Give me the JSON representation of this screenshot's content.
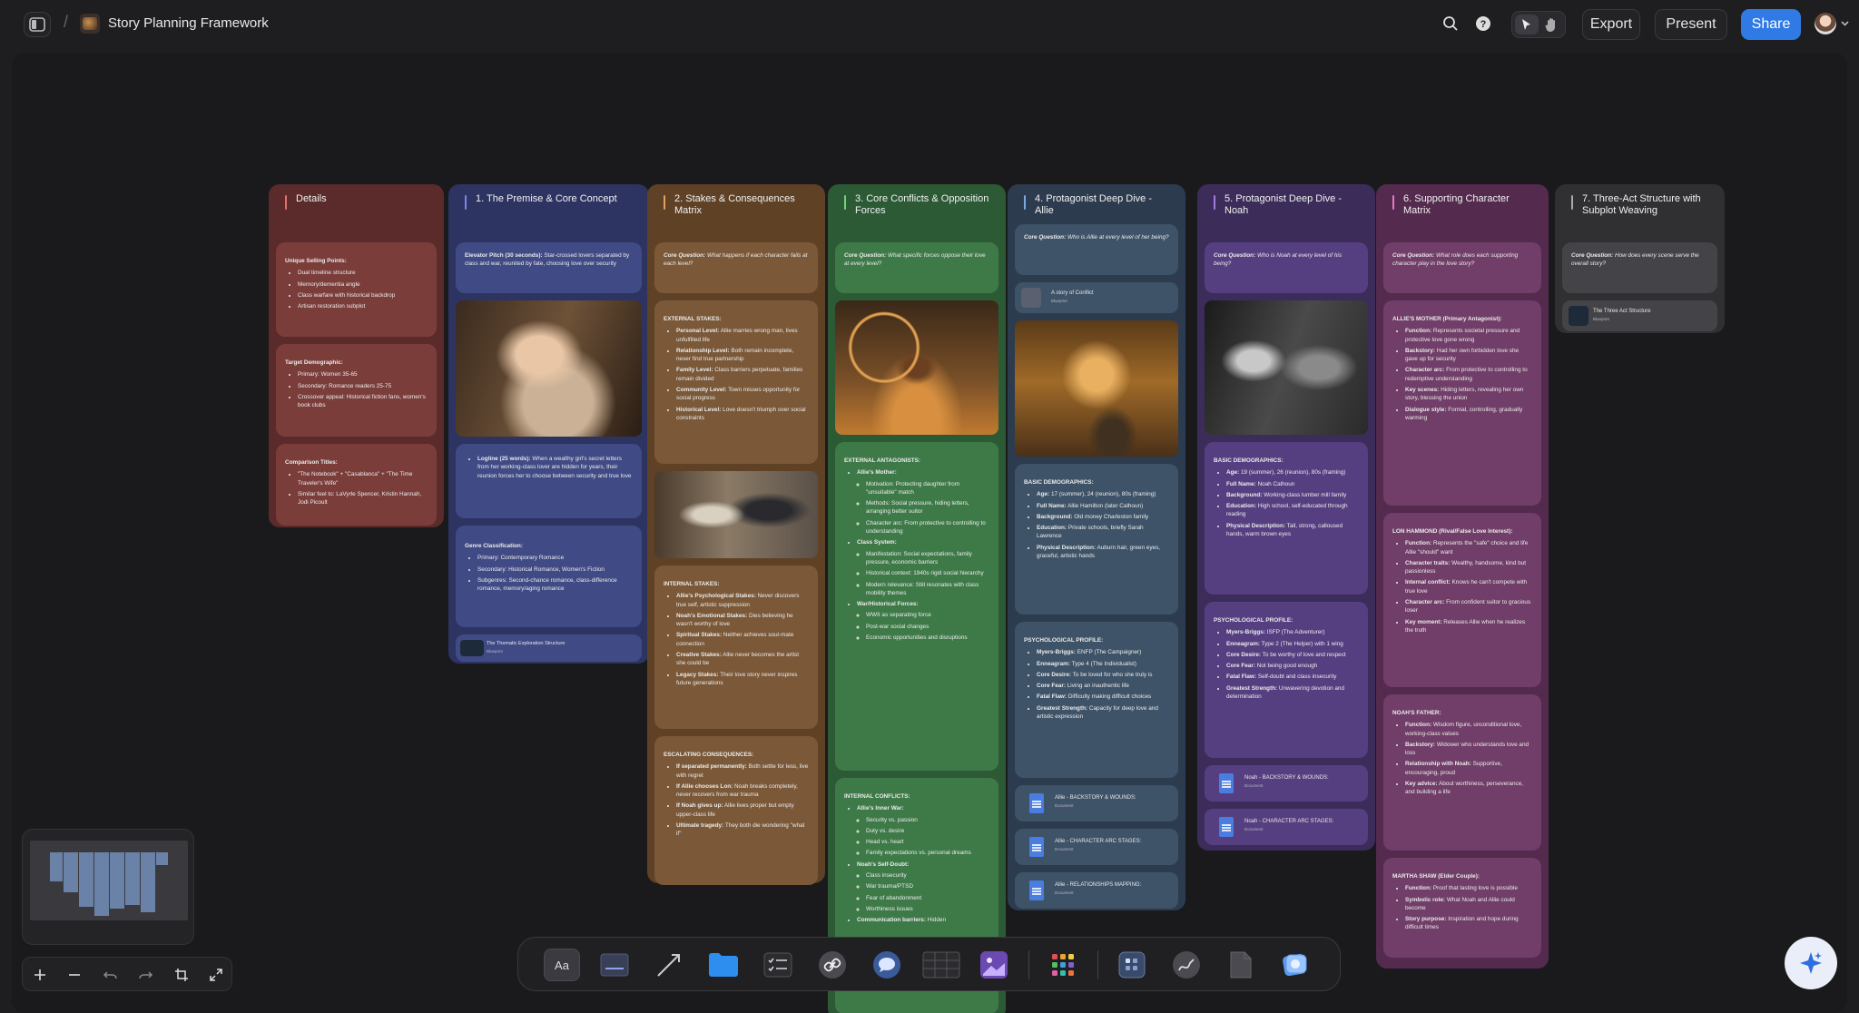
{
  "header": {
    "title": "Story Planning Framework",
    "export_label": "Export",
    "present_label": "Present",
    "share_label": "Share",
    "icons": [
      "sidebar-toggle-icon",
      "search-icon",
      "help-icon",
      "pointer-icon",
      "hand-icon",
      "avatar",
      "chevron-down-icon"
    ]
  },
  "columns": {
    "details": {
      "title": "Details",
      "c1h": "Unique Selling Points:",
      "c1": [
        "Dual timeline structure",
        "Memory/dementia angle",
        "Class warfare with historical backdrop",
        "Artisan restoration subplot"
      ],
      "c2h": "Target Demographic:",
      "c2": [
        "Primary: Women 35-65",
        "Secondary: Romance readers 25-75",
        "Crossover appeal: Historical fiction fans, women's book clubs"
      ],
      "c3h": "Comparison Titles:",
      "c3": [
        "\"The Notebook\" + \"Casablanca\" + \"The Time Traveler's Wife\"",
        "Similar feel to: LaVyrle Spencer, Kristin Hannah, Jodi Picoult"
      ]
    },
    "premise": {
      "title": "1. The Premise & Core Concept",
      "pitch_h": "Elevator Pitch (30 seconds):",
      "pitch": "Star-crossed lovers separated by class and war, reunited by fate, choosing love over security",
      "log_h": "Logline (25 words):",
      "log": "When a wealthy girl's secret letters from her working-class lover are hidden for years, their reunion forces her to choose between security and true love",
      "genre_h": "Genre Classification:",
      "genre": [
        "Primary: Contemporary Romance",
        "Secondary: Historical Romance, Women's Fiction",
        "Subgenres: Second-chance romance, class-difference romance, memory/aging romance"
      ],
      "link": "The Thematic Exploration Structure",
      "link_sub": "Blueprint"
    },
    "stakes": {
      "title": "2. Stakes & Consequences Matrix",
      "q_h": "Core Question:",
      "q": "What happens if each character fails at each level?",
      "ext_h": "EXTERNAL STAKES:",
      "ext": [
        [
          "Personal Level:",
          "Allie marries wrong man, lives unfulfilled life"
        ],
        [
          "Relationship Level:",
          "Both remain incomplete, never find true partnership"
        ],
        [
          "Family Level:",
          "Class barriers perpetuate, families remain divided"
        ],
        [
          "Community Level:",
          "Town misses opportunity for social progress"
        ],
        [
          "Historical Level:",
          "Love doesn't triumph over social constraints"
        ]
      ],
      "int_h": "INTERNAL STAKES:",
      "int": [
        [
          "Allie's Psychological Stakes:",
          "Never discovers true self, artistic suppression"
        ],
        [
          "Noah's Emotional Stakes:",
          "Dies believing he wasn't worthy of love"
        ],
        [
          "Spiritual Stakes:",
          "Neither achieves soul-mate connection"
        ],
        [
          "Creative Stakes:",
          "Allie never becomes the artist she could be"
        ],
        [
          "Legacy Stakes:",
          "Their love story never inspires future generations"
        ]
      ],
      "esc_h": "ESCALATING CONSEQUENCES:",
      "esc": [
        [
          "If separated permanently:",
          "Both settle for less, live with regret"
        ],
        [
          "If Allie chooses Lon:",
          "Noah breaks completely, never recovers from war trauma"
        ],
        [
          "If Noah gives up:",
          "Allie lives proper but empty upper-class life"
        ],
        [
          "Ultimate tragedy:",
          "They both die wondering \"what if\""
        ]
      ]
    },
    "conflicts": {
      "title": "3. Core Conflicts & Opposition Forces",
      "q_h": "Core Question:",
      "q": "What specific forces oppose their love at every level?",
      "ext_h": "EXTERNAL ANTAGONISTS:",
      "a1": "Allie's Mother:",
      "a1s": [
        "Motivation: Protecting daughter from \"unsuitable\" match",
        "Methods: Social pressure, hiding letters, arranging better suitor",
        "Character arc: From protective to controlling to understanding"
      ],
      "a2": "Class System:",
      "a2s": [
        "Manifestation: Social expectations, family pressure, economic barriers",
        "Historical context: 1940s rigid social hierarchy",
        "Modern relevance: Still resonates with class mobility themes"
      ],
      "a3": "War/Historical Forces:",
      "a3s": [
        "WWII as separating force",
        "Post-war social changes",
        "Economic opportunities and disruptions"
      ],
      "int_h": "INTERNAL CONFLICTS:",
      "i1": "Allie's Inner War:",
      "i1s": [
        "Security vs. passion",
        "Duty vs. desire",
        "Head vs. heart",
        "Family expectations vs. personal dreams"
      ],
      "i2": "Noah's Self-Doubt:",
      "i2s": [
        "Class insecurity",
        "War trauma/PTSD",
        "Fear of abandonment",
        "Worthiness issues"
      ],
      "i3": "Communication barriers:",
      "i3t": "Hidden"
    },
    "allie": {
      "title": "4. Protagonist Deep Dive - Allie",
      "q_h": "Core Question:",
      "q": "Who is Allie at every level of her being?",
      "link": "A story of Conflict",
      "link_sub": "Blueprint",
      "bd_h": "BASIC DEMOGRAPHICS:",
      "bd": [
        [
          "Age:",
          "17 (summer), 24 (reunion), 80s (framing)"
        ],
        [
          "Full Name:",
          "Allie Hamilton (later Calhoun)"
        ],
        [
          "Background:",
          "Old money Charleston family"
        ],
        [
          "Education:",
          "Private schools, briefly Sarah Lawrence"
        ],
        [
          "Physical Description:",
          "Auburn hair, green eyes, graceful, artistic hands"
        ]
      ],
      "pp_h": "PSYCHOLOGICAL PROFILE:",
      "pp": [
        [
          "Myers-Briggs:",
          "ENFP (The Campaigner)"
        ],
        [
          "Enneagram:",
          "Type 4 (The Individualist)"
        ],
        [
          "Core Desire:",
          "To be loved for who she truly is"
        ],
        [
          "Core Fear:",
          "Living an inauthentic life"
        ],
        [
          "Fatal Flaw:",
          "Difficulty making difficult choices"
        ],
        [
          "Greatest Strength:",
          "Capacity for deep love and artistic expression"
        ]
      ],
      "docs": [
        "Allie - BACKSTORY & WOUNDS:",
        "Allie - CHARACTER ARC STAGES:",
        "Allie - RELATIONSHIPS MAPPING:"
      ],
      "doc_sub": "Document"
    },
    "noah": {
      "title": "5. Protagonist Deep Dive - Noah",
      "q_h": "Core Question:",
      "q": "Who is Noah at every level of his being?",
      "bd_h": "BASIC DEMOGRAPHICS:",
      "bd": [
        [
          "Age:",
          "19 (summer), 26 (reunion), 80s (framing)"
        ],
        [
          "Full Name:",
          "Noah Calhoun"
        ],
        [
          "Background:",
          "Working-class lumber mill family"
        ],
        [
          "Education:",
          "High school, self-educated through reading"
        ],
        [
          "Physical Description:",
          "Tall, strong, calloused hands, warm brown eyes"
        ]
      ],
      "pp_h": "PSYCHOLOGICAL PROFILE:",
      "pp": [
        [
          "Myers-Briggs:",
          "ISFP (The Adventurer)"
        ],
        [
          "Enneagram:",
          "Type 2 (The Helper) with 1 wing"
        ],
        [
          "Core Desire:",
          "To be worthy of love and respect"
        ],
        [
          "Core Fear:",
          "Not being good enough"
        ],
        [
          "Fatal Flaw:",
          "Self-doubt and class insecurity"
        ],
        [
          "Greatest Strength:",
          "Unwavering devotion and determination"
        ]
      ],
      "docs": [
        "Noah - BACKSTORY & WOUNDS:",
        "Noah - CHARACTER ARC STAGES:"
      ],
      "doc_sub": "Document"
    },
    "support": {
      "title": "6. Supporting Character Matrix",
      "q_h": "Core Question:",
      "q": "What role does each supporting character play in the love story?",
      "m_h": "ALLIE'S MOTHER (Primary Antagonist):",
      "m": [
        [
          "Function:",
          "Represents societal pressure and protective love gone wrong"
        ],
        [
          "Backstory:",
          "Had her own forbidden love she gave up for security"
        ],
        [
          "Character arc:",
          "From protective to controlling to redemptive understanding"
        ],
        [
          "Key scenes:",
          "Hiding letters, revealing her own story, blessing the union"
        ],
        [
          "Dialogue style:",
          "Formal, controlling, gradually warming"
        ]
      ],
      "l_h": "LON HAMMOND (Rival/False Love Interest):",
      "l": [
        [
          "Function:",
          "Represents the \"safe\" choice and life Allie \"should\" want"
        ],
        [
          "Character traits:",
          "Wealthy, handsome, kind but passionless"
        ],
        [
          "Internal conflict:",
          "Knows he can't compete with true love"
        ],
        [
          "Character arc:",
          "From confident suitor to gracious loser"
        ],
        [
          "Key moment:",
          "Releases Allie when he realizes the truth"
        ]
      ],
      "f_h": "NOAH'S FATHER:",
      "f": [
        [
          "Function:",
          "Wisdom figure, unconditional love, working-class values"
        ],
        [
          "Backstory:",
          "Widower who understands love and loss"
        ],
        [
          "Relationship with Noah:",
          "Supportive, encouraging, proud"
        ],
        [
          "Key advice:",
          "About worthiness, perseverance, and building a life"
        ]
      ],
      "s_h": "MARTHA SHAW (Elder Couple):",
      "s": [
        [
          "Function:",
          "Proof that lasting love is possible"
        ],
        [
          "Symbolic role:",
          "What Noah and Allie could become"
        ],
        [
          "Story purpose:",
          "Inspiration and hope during difficult times"
        ]
      ]
    },
    "weaving": {
      "title": "7. Three-Act Structure with Subplot Weaving",
      "q_h": "Core Question:",
      "q": "How does every scene serve the overall story?",
      "link": "The Three Act Structure",
      "link_sub": "Blueprint"
    }
  },
  "toolbar": {
    "text_label": "Aa",
    "icons": [
      "text-tool-icon",
      "sticky-note-icon",
      "arrow-tool-icon",
      "folder-icon",
      "checklist-icon",
      "link-icon",
      "comment-icon",
      "table-icon",
      "image-generate-icon",
      "apps-grid-icon",
      "board-icon",
      "draw-icon",
      "document-icon",
      "ai-image-icon"
    ]
  },
  "zoom": {
    "icons": [
      "zoom-in-icon",
      "zoom-out-icon",
      "undo-icon",
      "redo-icon",
      "fit-frame-icon",
      "fullscreen-icon"
    ]
  },
  "colors": {
    "details": "#5a2b2a",
    "premise": "#2d3462",
    "stakes": "#5f4126",
    "conflicts": "#2c5a35",
    "allie": "#2c3c4e",
    "noah": "#3c2c5a",
    "support": "#542a4e",
    "weaving": "#303032",
    "accent": "#2f7ae5"
  }
}
